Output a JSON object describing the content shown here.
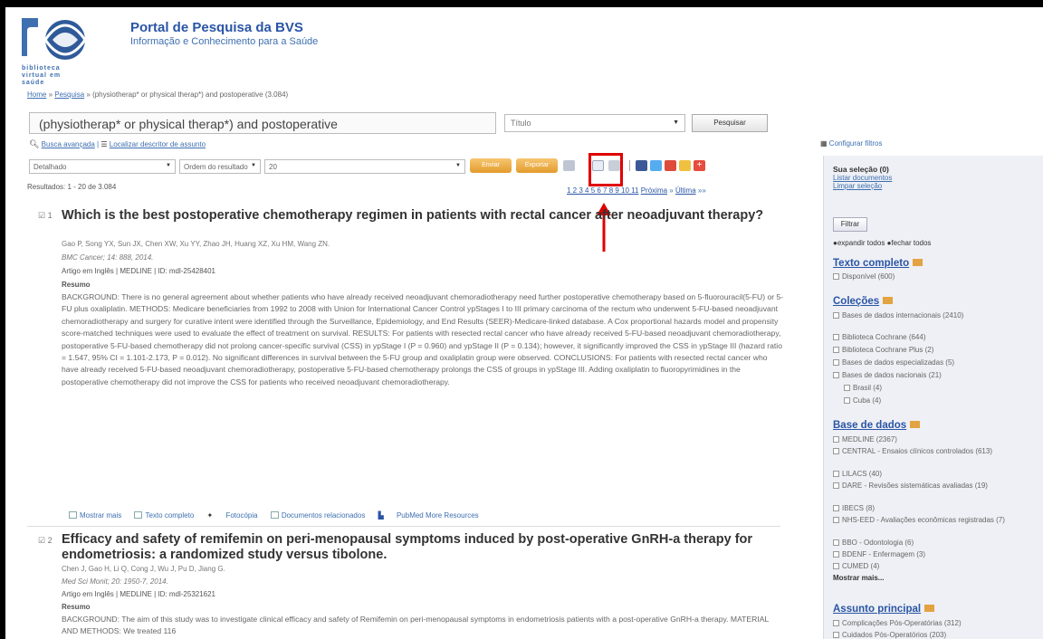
{
  "header": {
    "logo_text": "biblioteca virtual em saúde",
    "title": "Portal de Pesquisa da BVS",
    "subtitle": "Informação e Conhecimento para a Saúde"
  },
  "breadcrumb": {
    "home": "Home",
    "sep1": " » ",
    "search": "Pesquisa",
    "rest": " » (physiotherap* or physical therap*) and postoperative (3.084)"
  },
  "search": {
    "query": "(physiotherap* or physical therap*) and postoperative",
    "field": "Título",
    "button": "Pesquisar",
    "advanced": "Busca avançada",
    "divider": " | ",
    "decs": "Localizar descritor de assunto",
    "config": "Configurar filtros"
  },
  "toolbar": {
    "format": "Detalhado",
    "order": "Ordem do resultado",
    "per_page": "20",
    "btn1": "Enviar",
    "btn2": "Exportar",
    "icons": [
      "print-icon",
      "rss-icon",
      "save-icon",
      "facebook-icon",
      "twitter-icon",
      "google-plus-icon",
      "delicious-icon",
      "add-icon"
    ],
    "colors": {
      "facebook": "#3b5998",
      "twitter": "#55acee",
      "google": "#dd4b39",
      "delicious": "#f0c040",
      "add": "#e74c3c"
    }
  },
  "results": {
    "count": "Resultados: 1 - 20 de 3.084",
    "pager": {
      "pages": "1 2 3 4 5 6 7 8 9 10 11",
      "next": "Próxima",
      "sep": " » ",
      "last": "Última",
      "end": " »»"
    },
    "items": [
      {
        "number": "1",
        "title": "Which is the best postoperative chemotherapy regimen in patients with rectal cancer after neoadjuvant therapy?",
        "authors": "Gao P, Song YX, Sun JX, Chen XW, Xu YY, Zhao JH, Huang XZ, Xu HM, Wang ZN.",
        "source": "BMC Cancer; 14: 888, 2014.",
        "meta": "Artigo em Inglês | MEDLINE | ID: mdl-25428401",
        "abstract_label": "Resumo",
        "abstract": "BACKGROUND: There is no general agreement about whether patients who have already received neoadjuvant chemoradiotherapy need further postoperative chemotherapy based on 5-fluorouracil(5-FU) or 5-FU plus oxaliplatin. METHODS: Medicare beneficiaries from 1992 to 2008 with Union for International Cancer Control ypStages I to III primary carcinoma of the rectum who underwent 5-FU-based neoadjuvant chemoradiotherapy and surgery for curative intent were identified through the Surveillance, Epidemiology, and End Results (SEER)-Medicare-linked database. A Cox proportional hazards model and propensity score-matched techniques were used to evaluate the effect of treatment on survival. RESULTS: For patients with resected rectal cancer who have already received 5-FU-based neoadjuvant chemoradiotherapy, postoperative 5-FU-based chemotherapy did not prolong cancer-specific survival (CSS) in ypStage I (P = 0.960) and ypStage II (P = 0.134); however, it significantly improved the CSS in ypStage III (hazard ratio = 1.547, 95% CI = 1.101-2.173, P = 0.012). No significant differences in survival between the 5-FU group and oxaliplatin group were observed. CONCLUSIONS: For patients with resected rectal cancer who have already received 5-FU-based neoadjuvant chemoradiotherapy, postoperative 5-FU-based chemotherapy prolongs the CSS of groups in ypStage III. Adding oxaliplatin to fluoropyrimidines in the postoperative chemotherapy did not improve the CSS for patients who received neoadjuvant chemoradiotherapy.",
        "actions": [
          "Mostrar mais",
          "Texto completo",
          "Fotocópia",
          "Documentos relacionados",
          "PubMed More Resources"
        ]
      },
      {
        "number": "2",
        "title": "Efficacy and safety of remifemin on peri-menopausal symptoms induced by post-operative GnRH-a therapy for endometriosis: a randomized study versus tibolone.",
        "authors": "Chen J, Gao H, Li Q, Cong J, Wu J, Pu D, Jiang G.",
        "source": "Med Sci Monit; 20: 1950-7, 2014.",
        "meta": "Artigo em Inglês | MEDLINE | ID: mdl-25321621",
        "abstract_label": "Resumo",
        "abstract": "BACKGROUND: The aim of this study was to investigate clinical efficacy and safety of Remifemin on peri-menopausal symptoms in endometriosis patients with a post-operative GnRH-a therapy. MATERIAL AND METHODS: We treated 116"
      }
    ]
  },
  "sidebar": {
    "selection_title": "Sua seleção (0)",
    "list_docs": "Listar documentos",
    "clear_selection": "Limpar seleção",
    "filter_button": "Filtrar",
    "expand_all": "expandir todos",
    "close_all": "fechar todos",
    "sections": [
      {
        "title": "Texto completo",
        "items": [
          "Disponível (600)"
        ]
      },
      {
        "title": "Coleções",
        "items": [
          "Bases de dados internacionais (2410)",
          "Biblioteca Cochrane (644)",
          "Biblioteca Cochrane Plus (2)",
          "Bases de dados especializadas (5)",
          "Bases de dados nacionais (21)",
          "Brasil (4)",
          "Cuba (4)"
        ]
      },
      {
        "title": "Base de dados",
        "items": [
          "MEDLINE (2367)",
          "CENTRAL - Ensaios clínicos controlados (613)",
          "LILACS (40)",
          "DARE - Revisões sistemáticas avaliadas (19)",
          "IBECS (8)",
          "NHS-EED - Avaliações econômicas registradas (7)",
          "BBO - Odontologia (6)",
          "BDENF - Enfermagem (3)",
          "CUMED (4)"
        ],
        "more": "Mostrar mais..."
      },
      {
        "title": "Assunto principal",
        "items": [
          "Complicações Pós-Operatórias (312)",
          "Cuidados Pós-Operatórios (203)"
        ]
      }
    ]
  }
}
